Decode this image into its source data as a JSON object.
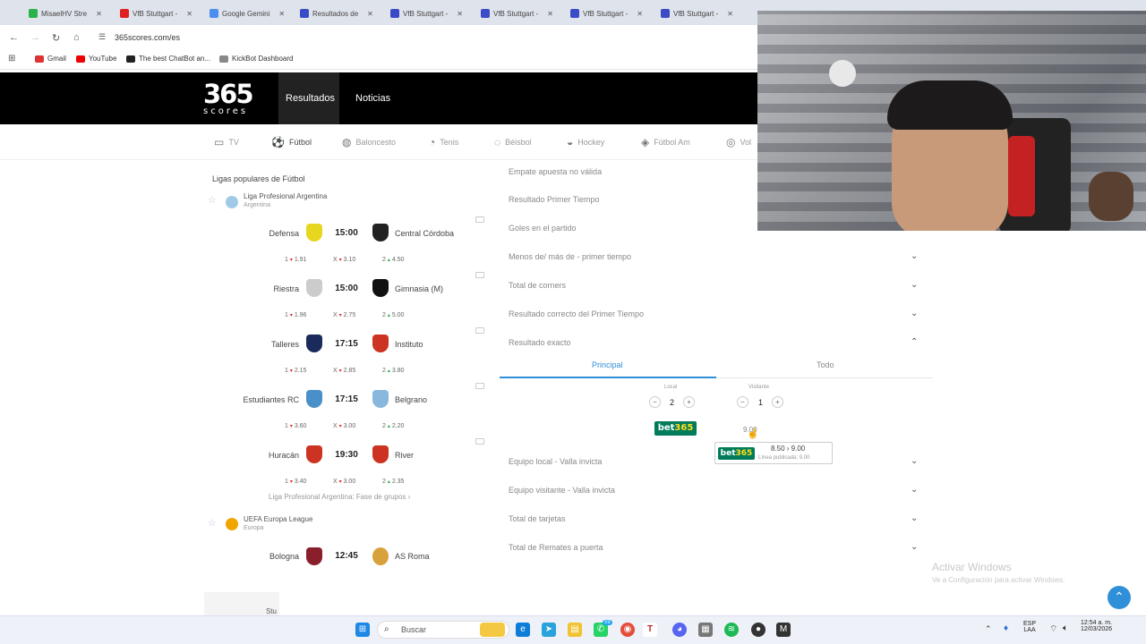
{
  "browser": {
    "tabs": [
      {
        "label": "MisaelHV Stre",
        "color": "#2bb24c"
      },
      {
        "label": "VfB Stuttgart -",
        "color": "#e02020"
      },
      {
        "label": "Google Gemini",
        "color": "#4a8ff0"
      },
      {
        "label": "Resultados de",
        "color": "#3b4bc8"
      },
      {
        "label": "VfB Stuttgart -",
        "color": "#3b4bc8"
      },
      {
        "label": "VfB Stuttgart -",
        "color": "#3b4bc8"
      },
      {
        "label": "VfB Stuttgart -",
        "color": "#3b4bc8"
      },
      {
        "label": "VfB Stuttgart -",
        "color": "#3b4bc8"
      }
    ],
    "url": "365scores.com/es",
    "bookmarks": [
      {
        "label": "Gmail",
        "color": "#d33"
      },
      {
        "label": "YouTube",
        "color": "#e00"
      },
      {
        "label": "The best ChatBot an...",
        "color": "#222"
      },
      {
        "label": "KickBot Dashboard",
        "color": "#888"
      }
    ]
  },
  "site": {
    "logo_num": "365",
    "logo_txt": "scores",
    "nav": [
      "Resultados",
      "Noticias"
    ],
    "sports": [
      "TV",
      "Fútbol",
      "Baloncesto",
      "Tenis",
      "Béisbol",
      "Hockey",
      "Fútbol Am",
      "Vol"
    ]
  },
  "left": {
    "title": "Ligas populares de Fútbol",
    "league1": {
      "name": "Liga Profesional Argentina",
      "country": "Argentina"
    },
    "matches": [
      {
        "home": "Defensa",
        "time": "15:00",
        "away": "Central Córdoba",
        "o1": "1.91",
        "ox": "3.10",
        "o2": "4.50"
      },
      {
        "home": "Riestra",
        "time": "15:00",
        "away": "Gimnasia (M)",
        "o1": "1.96",
        "ox": "2.75",
        "o2": "5.00"
      },
      {
        "home": "Talleres",
        "time": "17:15",
        "away": "Instituto",
        "o1": "2.15",
        "ox": "2.85",
        "o2": "3.80"
      },
      {
        "home": "Estudiantes RC",
        "time": "17:15",
        "away": "Belgrano",
        "o1": "3.60",
        "ox": "3.00",
        "o2": "2.20"
      },
      {
        "home": "Huracán",
        "time": "19:30",
        "away": "River",
        "o1": "3.40",
        "ox": "3.00",
        "o2": "2.35"
      }
    ],
    "odd_labels": {
      "one": "1",
      "x": "X",
      "two": "2"
    },
    "league_link": "Liga Profesional Argentina: Fase de grupos ›",
    "league2": {
      "name": "UEFA Europa League",
      "country": "Europa"
    },
    "match_eu": {
      "home": "Bologna",
      "time": "12:45",
      "away": "AS Roma"
    },
    "stub": "Stu"
  },
  "right": {
    "markets_top": [
      "Empate apuesta no válida",
      "Resultado Primer Tiempo",
      "Goles en el partido",
      "Menos de/ más de - primer tiempo",
      "Total de corners",
      "Resultado correcto del Primer Tiempo",
      "Resultado exacto"
    ],
    "tabs": [
      "Principal",
      "Todo"
    ],
    "local_label": "Local",
    "visitor_label": "Visitante",
    "local_score": "2",
    "visitor_score": "1",
    "bet_odds": "9.00",
    "tooltip_range": "8.50 › 9.00",
    "tooltip_sub": "Línea publicada: 9.00",
    "markets_bottom": [
      "Equipo local - Valla invicta",
      "Equipo visitante - Valla invicta",
      "Total de tarjetas",
      "Total de Remates a puerta"
    ]
  },
  "bet365_brand": {
    "a": "bet",
    "b": "365"
  },
  "windows": {
    "activate_title": "Activar Windows",
    "activate_sub": "Ve a Configuración para activar Windows.",
    "search": "Buscar",
    "lang": "ESP",
    "lang2": "LAA",
    "clock": "12:54 a. m.",
    "date": "12/03/2026",
    "badge": "59"
  }
}
